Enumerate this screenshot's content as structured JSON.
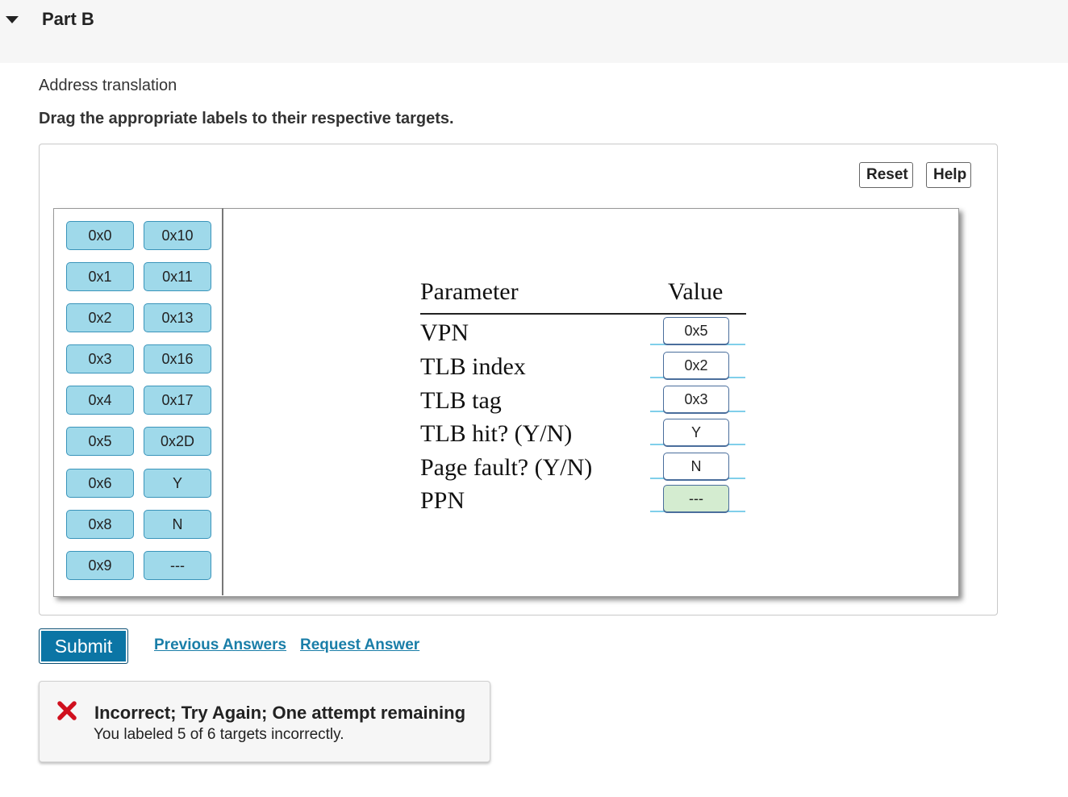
{
  "part": {
    "title": "Part B"
  },
  "question": {
    "subtitle": "Address translation",
    "instructions": "Drag the appropriate labels to their respective targets."
  },
  "toolbar": {
    "reset_label": "Reset",
    "help_label": "Help"
  },
  "label_bank": {
    "column1": [
      "0x0",
      "0x1",
      "0x2",
      "0x3",
      "0x4",
      "0x5",
      "0x6",
      "0x8",
      "0x9"
    ],
    "column2": [
      "0x10",
      "0x11",
      "0x13",
      "0x16",
      "0x17",
      "0x2D",
      "Y",
      "N",
      "---"
    ]
  },
  "table": {
    "header_parameter": "Parameter",
    "header_value": "Value",
    "rows": [
      {
        "parameter": "VPN",
        "value": "0x5",
        "status": "incorrect"
      },
      {
        "parameter": "TLB index",
        "value": "0x2",
        "status": "incorrect"
      },
      {
        "parameter": "TLB tag",
        "value": "0x3",
        "status": "incorrect"
      },
      {
        "parameter": "TLB hit? (Y/N)",
        "value": "Y",
        "status": "incorrect"
      },
      {
        "parameter": "Page fault? (Y/N)",
        "value": "N",
        "status": "incorrect"
      },
      {
        "parameter": "PPN",
        "value": "---",
        "status": "correct"
      }
    ]
  },
  "actions": {
    "submit_label": "Submit",
    "previous_answers_label": "Previous Answers",
    "request_answer_label": "Request Answer"
  },
  "feedback": {
    "title": "Incorrect; Try Again; One attempt remaining",
    "detail": "You labeled 5 of 6 targets incorrectly."
  },
  "colors": {
    "label_fill": "#9fd9ea",
    "correct_fill": "#d4ecd0",
    "submit_blue": "#0b75a5",
    "link_blue": "#1a7ea8",
    "error_red": "#d0101e"
  }
}
